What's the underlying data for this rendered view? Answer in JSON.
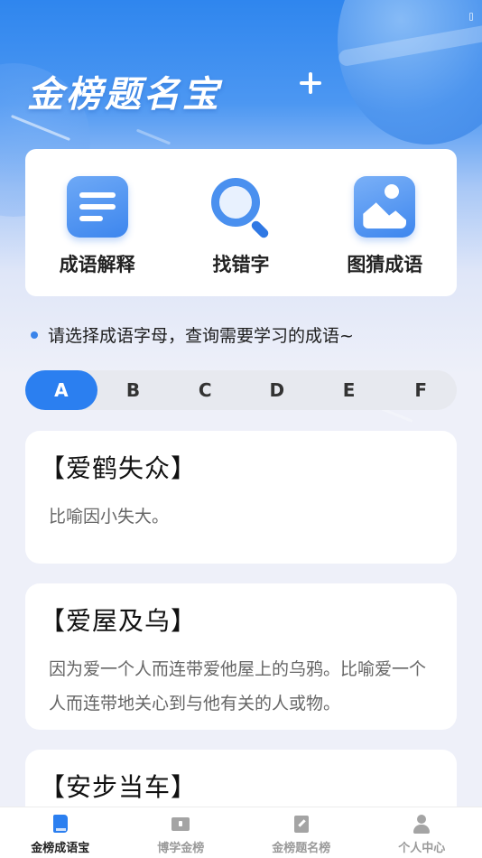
{
  "header": {
    "title": "金榜题名宝"
  },
  "tools": [
    {
      "label": "成语解释",
      "icon": "document-icon"
    },
    {
      "label": "找错字",
      "icon": "search-icon"
    },
    {
      "label": "图猜成语",
      "icon": "image-icon"
    }
  ],
  "hint": {
    "text": "请选择成语字母，查询需要学习的成语~"
  },
  "letters": {
    "items": [
      "A",
      "B",
      "C",
      "D",
      "E",
      "F"
    ],
    "selected": "A"
  },
  "idioms": [
    {
      "title": "【爱鹤失众】",
      "desc": "比喻因小失大。"
    },
    {
      "title": "【爱屋及乌】",
      "desc": "因为爱一个人而连带爱他屋上的乌鸦。比喻爱一个人而连带地关心到与他有关的人或物。"
    },
    {
      "title": "【安步当车】",
      "desc": ""
    }
  ],
  "tabbar": {
    "items": [
      {
        "label": "金榜成语宝",
        "icon": "book-icon",
        "active": true
      },
      {
        "label": "博学金榜",
        "icon": "open-book-icon",
        "active": false
      },
      {
        "label": "金榜题名榜",
        "icon": "note-icon",
        "active": false
      },
      {
        "label": "个人中心",
        "icon": "person-icon",
        "active": false
      }
    ]
  },
  "colors": {
    "accent": "#2b7ff0",
    "background": "#eef0f9",
    "text": "#222222",
    "muted": "#666666"
  }
}
